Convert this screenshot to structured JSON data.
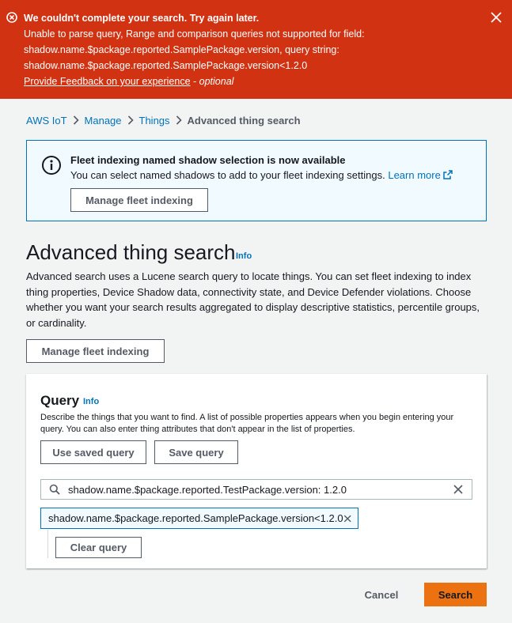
{
  "error": {
    "title": "We couldn't complete your search. Try again later.",
    "line1": "Unable to parse query, Range and comparison queries not supported for field:",
    "line2": "shadow.name.$package.reported.SamplePackage.version, query string:",
    "line3": "shadow.name.$package.reported.SamplePackage.version<1.2.0",
    "feedback_link": "Provide Feedback on your experience",
    "feedback_sep": " - ",
    "feedback_optional": "optional",
    "icon": "error-circle-icon",
    "close_icon": "close-icon",
    "color": "#d13212"
  },
  "breadcrumb": {
    "items": [
      "AWS IoT",
      "Manage",
      "Things"
    ],
    "current": "Advanced thing search"
  },
  "info": {
    "title": "Fleet indexing named shadow selection is now available",
    "text": "You can select named shadows to add to your fleet indexing settings.",
    "link": "Learn more",
    "button": "Manage fleet indexing"
  },
  "page": {
    "title": "Advanced thing search",
    "info_label": "Info",
    "description": "Advanced search uses a Lucene search query to locate things. You can set fleet indexing to index thing properties, Device Shadow data, connectivity state, and Device Defender violations. Choose whether you want your search results aggregated to display descriptive statistics, percentile groups, or cardinality.",
    "manage_button": "Manage fleet indexing"
  },
  "query": {
    "title": "Query",
    "info_label": "Info",
    "description": "Describe the things that you want to find. A list of possible properties appears when you begin entering your query. You can also enter thing attributes that don't appear in the list of properties.",
    "use_saved": "Use saved query",
    "save": "Save query",
    "search_value": "shadow.name.$package.reported.TestPackage.version: 1.2.0",
    "token": "shadow.name.$package.reported.SamplePackage.version<1.2.0",
    "clear": "Clear query"
  },
  "footer": {
    "cancel": "Cancel",
    "search": "Search",
    "accent": "#ec7211"
  }
}
